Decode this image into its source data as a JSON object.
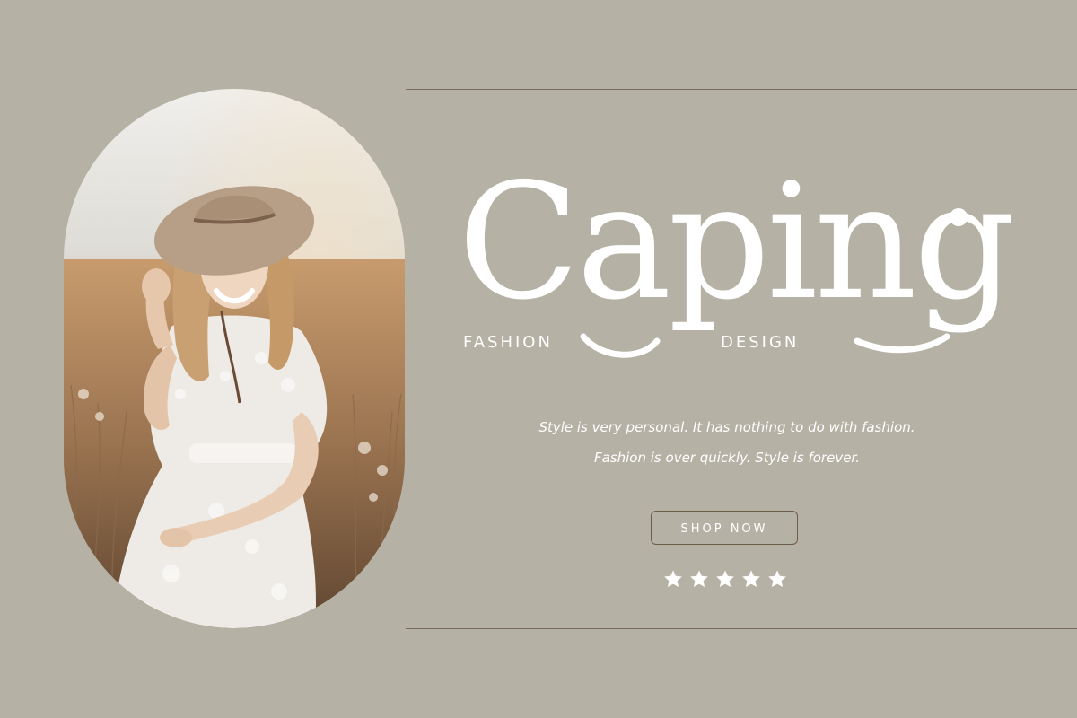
{
  "brand": {
    "name": "Caping",
    "left_label": "FASHION",
    "right_label": "DESIGN"
  },
  "quotes": [
    "Style is very personal. It has nothing to do with fashion.",
    "Fashion is over quickly. Style is forever."
  ],
  "cta": {
    "label": "SHOP NOW"
  },
  "rating": {
    "stars": 5,
    "icon": "star-icon"
  },
  "colors": {
    "background": "#b5b1a4",
    "accent_line": "#7a6a5c",
    "text": "#ffffff",
    "button_border": "#6e5c4b"
  },
  "image": {
    "subject": "woman in white lace dress and wide-brim hat in a golden field"
  }
}
